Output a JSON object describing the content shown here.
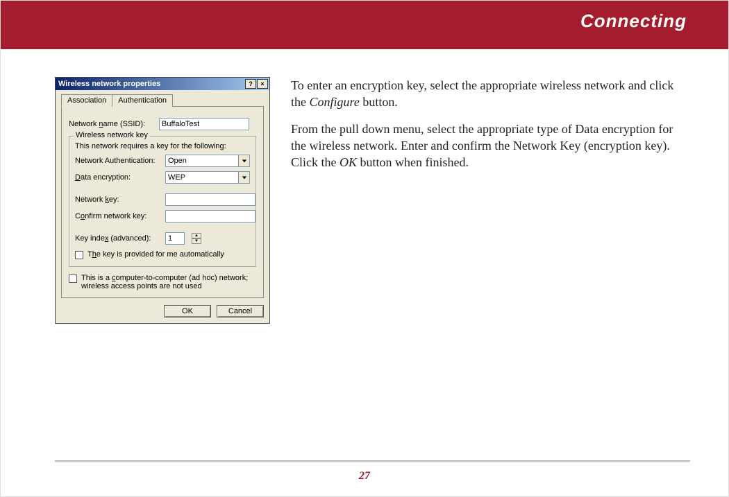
{
  "header": {
    "title": "Connecting"
  },
  "dialog": {
    "title": "Wireless network properties",
    "help_btn": "?",
    "close_btn": "×",
    "tabs": {
      "association": "Association",
      "authentication": "Authentication"
    },
    "ssid_label_pre": "Network ",
    "ssid_label_u": "n",
    "ssid_label_post": "ame (SSID):",
    "ssid_value": "BuffaloTest",
    "key_legend": "Wireless network key",
    "key_hint": "This network requires a key for the following:",
    "auth_label": "Network Authentication:",
    "auth_value": "Open",
    "enc_label_pre": "",
    "enc_label_u": "D",
    "enc_label_post": "ata encryption:",
    "enc_value": "WEP",
    "netkey_label_pre": "Network ",
    "netkey_label_u": "k",
    "netkey_label_post": "ey:",
    "confirm_label_pre": "C",
    "confirm_label_u": "o",
    "confirm_label_post": "nfirm network key:",
    "keyidx_label_pre": "Key inde",
    "keyidx_label_u": "x",
    "keyidx_label_post": " (advanced):",
    "keyidx_value": "1",
    "auto_label_pre": "T",
    "auto_label_u": "h",
    "auto_label_post": "e key is provided for me automatically",
    "adhoc_label_pre": "This is a ",
    "adhoc_label_u": "c",
    "adhoc_label_post": "omputer-to-computer (ad hoc) network; wireless access points are not used",
    "ok": "OK",
    "cancel": "Cancel"
  },
  "body": {
    "p1a": "To enter an encryption key, select the appropriate wireless network and click the ",
    "p1b": "Configure",
    "p1c": " button.",
    "p2a": "From the pull down menu, select the appropriate type of  Data encryption for the wireless network.  Enter and confirm the Network Key (encryption key).  Click the ",
    "p2b": "OK",
    "p2c": " button when finished."
  },
  "footer": {
    "page": "27"
  }
}
